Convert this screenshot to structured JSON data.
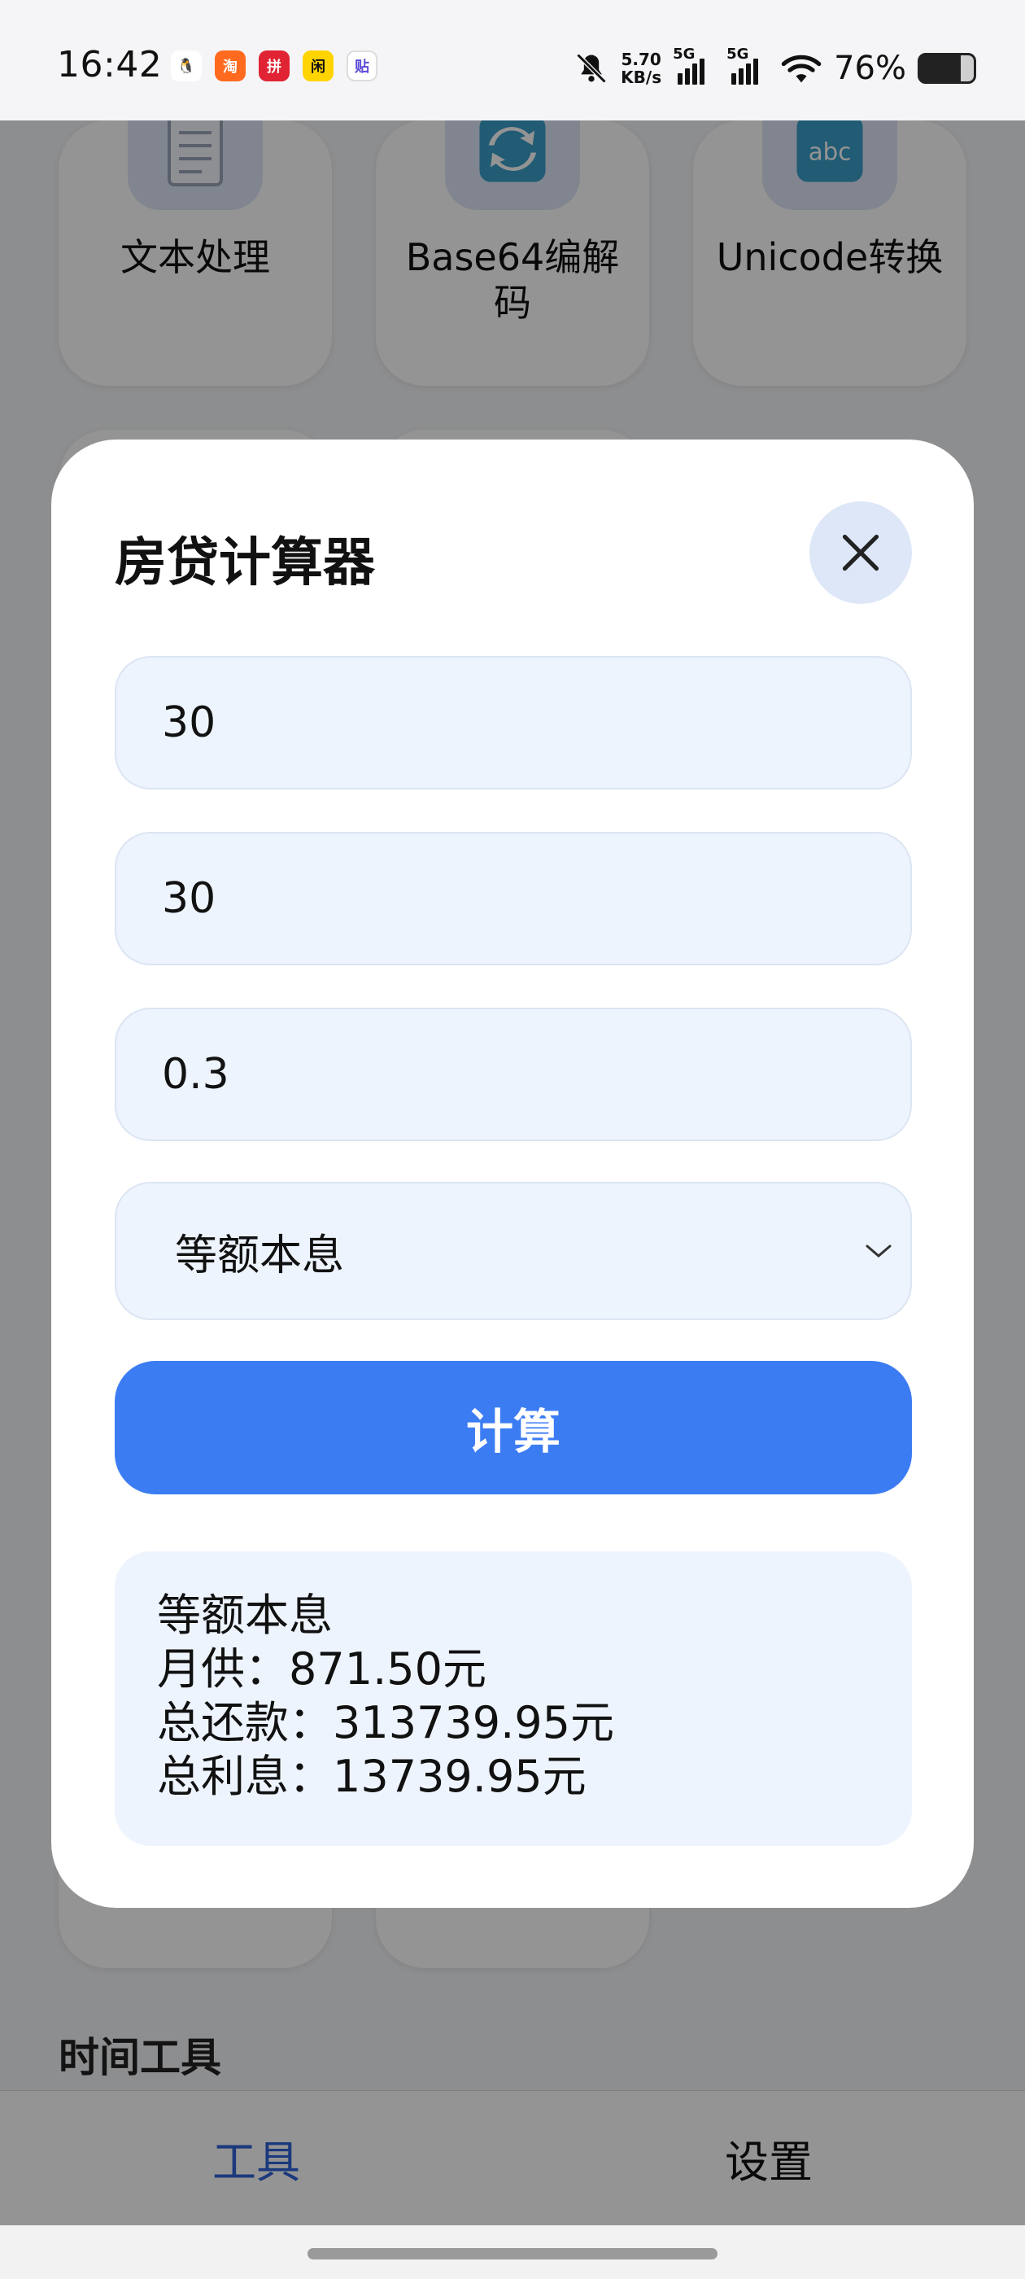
{
  "status_bar": {
    "time": "16:42",
    "net_speed_value": "5.70",
    "net_speed_unit": "KB/s",
    "sim1_label": "5G",
    "sim2_label": "5G",
    "battery_percent": "76%",
    "battery_level": 0.76,
    "app_icons": [
      "qq-icon",
      "taobao-icon",
      "pinduoduo-icon",
      "xianyu-icon",
      "tieba-icon"
    ],
    "app_icon_colors": [
      "#ffffff",
      "#ff6a1f",
      "#e02433",
      "#ffd400",
      "#ffffff"
    ]
  },
  "tools": [
    {
      "label": "文本处理",
      "icon": "document-icon"
    },
    {
      "label": "Base64编解码",
      "icon": "refresh-arrows-icon"
    },
    {
      "label": "Unicode转换",
      "icon": "abc-icon"
    }
  ],
  "section_title": "时间工具",
  "modal": {
    "title": "房贷计算器",
    "fields": [
      "30",
      "30",
      "0.3"
    ],
    "repayment_method": "等额本息",
    "calculate_label": "计算",
    "result_lines": [
      "等额本息",
      "月供：871.50元",
      "总还款：313739.95元",
      "总利息：13739.95元"
    ]
  },
  "bottom_nav": {
    "tools": "工具",
    "settings": "设置"
  },
  "colors": {
    "primary": "#3b7cf3",
    "field_bg": "#eef4fe",
    "nav_active": "#2f62d6"
  }
}
